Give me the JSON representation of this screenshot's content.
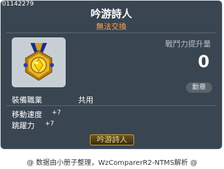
{
  "tooltip": {
    "item_id": "01142279",
    "item_name": "吟游詩人",
    "trade_status": "無法交換",
    "power_label": "戰鬥力提升量",
    "power_value": "0",
    "medal_badge": "勳章",
    "job_label": "裝備職業",
    "job_value": "共用",
    "stats": [
      {
        "name": "移動速度",
        "value": "+7"
      },
      {
        "name": "跳躍力",
        "value": "+7"
      }
    ],
    "title_tag": "吟游詩人",
    "icon": "gold-medal-icon"
  },
  "footer": {
    "credit": "@ 数据由小册子整理，WzComparerR2-NTMS解析 @"
  },
  "colors": {
    "background": "#394550",
    "trade_status": "#ffa64c",
    "medal_gold": "#f0b12a"
  }
}
